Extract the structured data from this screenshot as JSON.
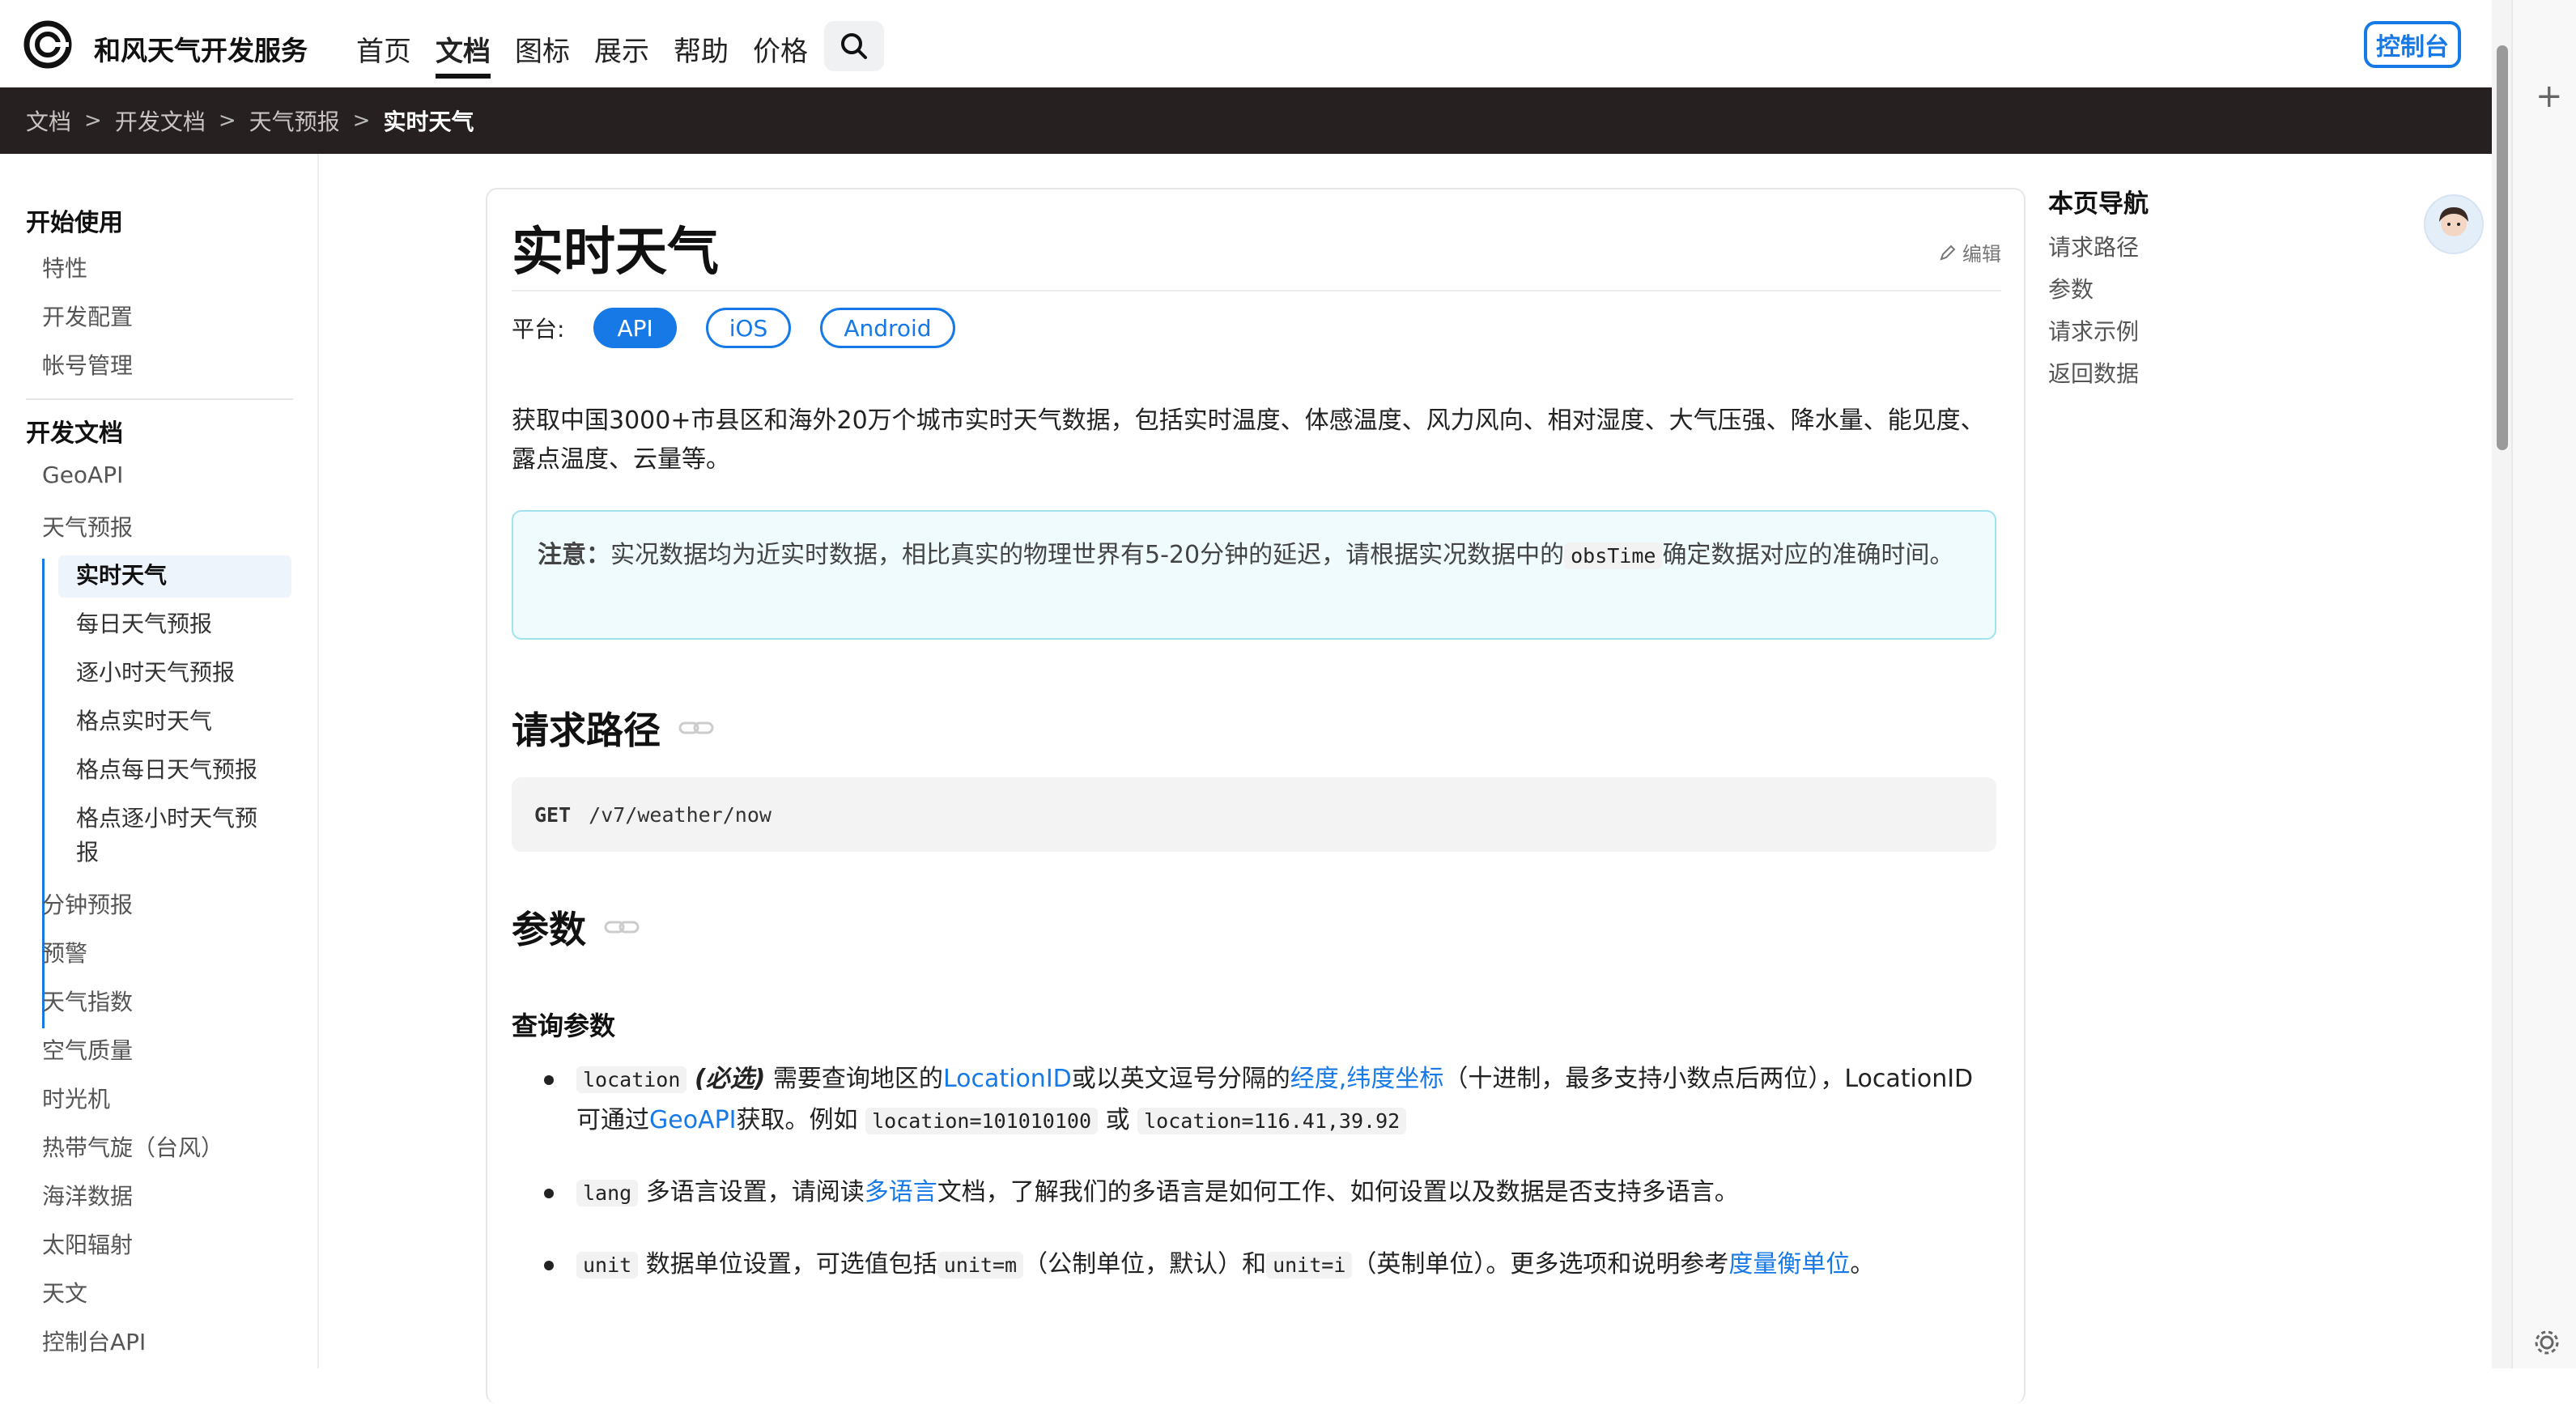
{
  "header": {
    "brand": "和风天气开发服务",
    "nav": [
      "首页",
      "文档",
      "图标",
      "展示",
      "帮助",
      "价格"
    ],
    "active_nav": "文档",
    "console_button": "控制台"
  },
  "breadcrumb": [
    "文档",
    "开发文档",
    "天气预报",
    "实时天气"
  ],
  "breadcrumb_sep": ">",
  "sidebar": {
    "section1_title": "开始使用",
    "section1_items": [
      "特性",
      "开发配置",
      "帐号管理"
    ],
    "section2_title": "开发文档",
    "geoapi": "GeoAPI",
    "weather": "天气预报",
    "weather_sub": [
      "实时天气",
      "每日天气预报",
      "逐小时天气预报",
      "格点实时天气",
      "格点每日天气预报",
      "格点逐小时天气预报"
    ],
    "more_items": [
      "分钟预报",
      "预警",
      "天气指数",
      "空气质量",
      "时光机",
      "热带气旋（台风）",
      "海洋数据",
      "太阳辐射",
      "天文",
      "控制台API"
    ]
  },
  "article": {
    "title": "实时天气",
    "edit": "编辑",
    "platform_label": "平台:",
    "platforms": [
      "API",
      "iOS",
      "Android"
    ],
    "intro": "获取中国3000+市县区和海外20万个城市实时天气数据，包括实时温度、体感温度、风力风向、相对湿度、大气压强、降水量、能见度、露点温度、云量等。",
    "note_label": "注意：",
    "note_text_1": "实况数据均为近实时数据，相比真实的物理世界有5-20分钟的延迟，请根据实况数据中的",
    "note_code": "obsTime",
    "note_text_2": "确定数据对应的准确时间。",
    "h2_path": "请求路径",
    "method": "GET",
    "path": "/v7/weather/now",
    "h2_params": "参数",
    "h3_query": "查询参数",
    "p_location": {
      "code": "location",
      "must": "(必选)",
      "t1": "需要查询地区的",
      "link1": "LocationID",
      "t2": "或以英文逗号分隔的",
      "link2": "经度,纬度坐标",
      "t3": "（十进制，最多支持小数点后两位），LocationID可通过",
      "link3": "GeoAPI",
      "t4": "获取。例如",
      "ex1": "location=101010100",
      "or": "或",
      "ex2": "location=116.41,39.92"
    },
    "p_lang": {
      "code": "lang",
      "t1": "多语言设置，请阅读",
      "link": "多语言",
      "t2": "文档，了解我们的多语言是如何工作、如何设置以及数据是否支持多语言。"
    },
    "p_unit": {
      "code": "unit",
      "t1": "数据单位设置，可选值包括",
      "c1": "unit=m",
      "t2": "（公制单位，默认）和",
      "c2": "unit=i",
      "t3": "（英制单位）。更多选项和说明参考",
      "link": "度量衡单位",
      "t4": "。"
    }
  },
  "toc": {
    "title": "本页导航",
    "items": [
      "请求路径",
      "参数",
      "请求示例",
      "返回数据"
    ]
  },
  "colors": {
    "accent": "#1679e6",
    "breadcrumb_bg": "#272020"
  }
}
